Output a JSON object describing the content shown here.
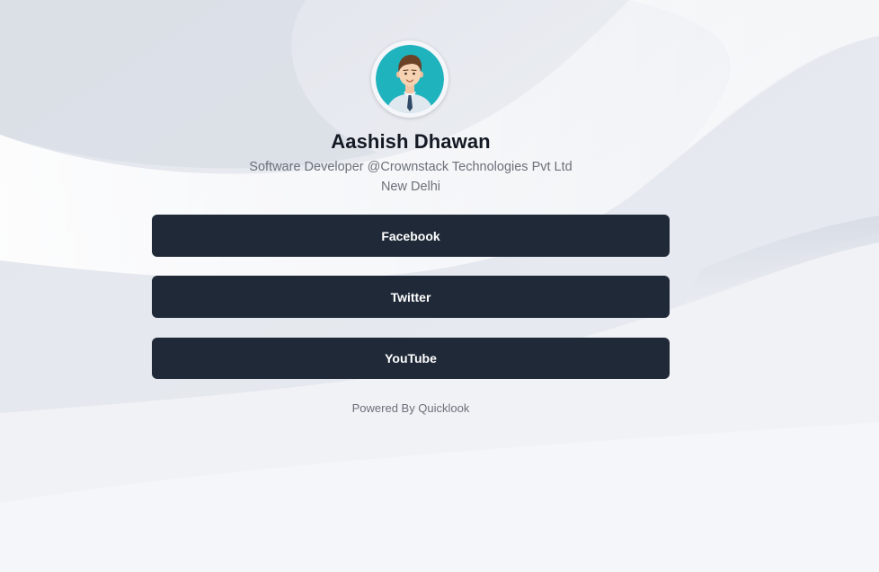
{
  "profile": {
    "name": "Aashish Dhawan",
    "title": "Software Developer @Crownstack Technologies Pvt Ltd",
    "location": "New Delhi",
    "avatar_icon": "man-avatar-icon"
  },
  "links": [
    {
      "label": "Facebook"
    },
    {
      "label": "Twitter"
    },
    {
      "label": "YouTube"
    }
  ],
  "footer": {
    "powered_by": "Powered By Quicklook"
  },
  "colors": {
    "button_bg": "#1f2937",
    "button_text": "#ffffff",
    "name_text": "#141a24",
    "muted_text": "#6b7079",
    "avatar_bg": "#1fb3bd"
  }
}
